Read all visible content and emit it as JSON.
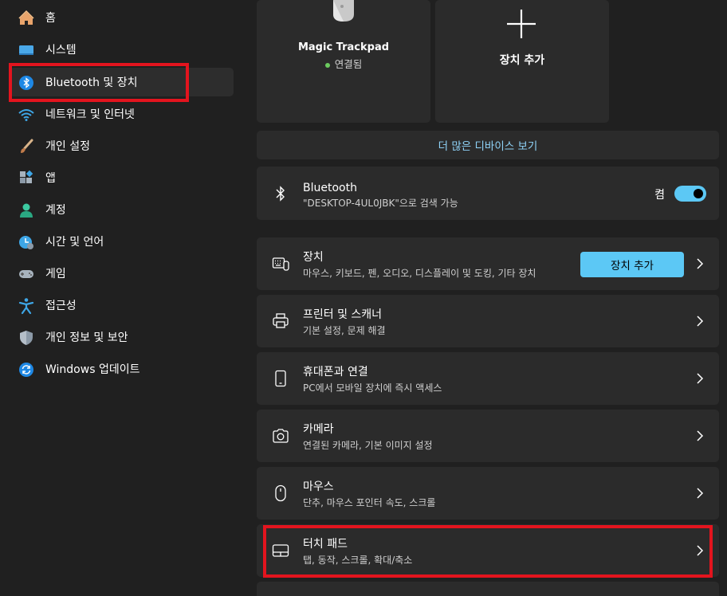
{
  "sidebar": {
    "items": [
      {
        "label": "홈",
        "icon": "home-icon"
      },
      {
        "label": "시스템",
        "icon": "system-icon"
      },
      {
        "label": "Bluetooth 및 장치",
        "icon": "bluetooth-icon"
      },
      {
        "label": "네트워크 및 인터넷",
        "icon": "wifi-icon"
      },
      {
        "label": "개인 설정",
        "icon": "brush-icon"
      },
      {
        "label": "앱",
        "icon": "apps-icon"
      },
      {
        "label": "계정",
        "icon": "account-icon"
      },
      {
        "label": "시간 및 언어",
        "icon": "time-language-icon"
      },
      {
        "label": "게임",
        "icon": "gamepad-icon"
      },
      {
        "label": "접근성",
        "icon": "accessibility-icon"
      },
      {
        "label": "개인 정보 및 보안",
        "icon": "shield-icon"
      },
      {
        "label": "Windows 업데이트",
        "icon": "update-icon"
      }
    ],
    "selected_index": 2
  },
  "devices": {
    "tile": {
      "name": "Magic Trackpad",
      "status": "연결됨"
    },
    "add_tile_label": "장치 추가",
    "more_link": "더 많은 디바이스 보기"
  },
  "bluetooth": {
    "title": "Bluetooth",
    "subtitle": "\"DESKTOP-4UL0JBK\"으로 검색 가능",
    "toggle_label": "켬",
    "toggle_on": true
  },
  "rows": [
    {
      "title": "장치",
      "subtitle": "마우스, 키보드, 펜, 오디오, 디스플레이 및 도킹, 기타 장치",
      "button": "장치 추가",
      "icon": "keyboard-icon"
    },
    {
      "title": "프린터 및 스캐너",
      "subtitle": "기본 설정, 문제 해결",
      "icon": "printer-icon"
    },
    {
      "title": "휴대폰과 연결",
      "subtitle": "PC에서 모바일 장치에 즉시 액세스",
      "icon": "phone-icon"
    },
    {
      "title": "카메라",
      "subtitle": "연결된 카메라, 기본 이미지 설정",
      "icon": "camera-icon"
    },
    {
      "title": "마우스",
      "subtitle": "단추, 마우스 포인터 속도, 스크롤",
      "icon": "mouse-icon"
    },
    {
      "title": "터치 패드",
      "subtitle": "탭, 동작, 스크롤, 확대/축소",
      "icon": "touchpad-icon"
    }
  ],
  "colors": {
    "background": "#202020",
    "card": "#2b2b2b",
    "accent": "#5cc8f5",
    "link": "#8fd3f8",
    "highlight": "#e3141e"
  }
}
